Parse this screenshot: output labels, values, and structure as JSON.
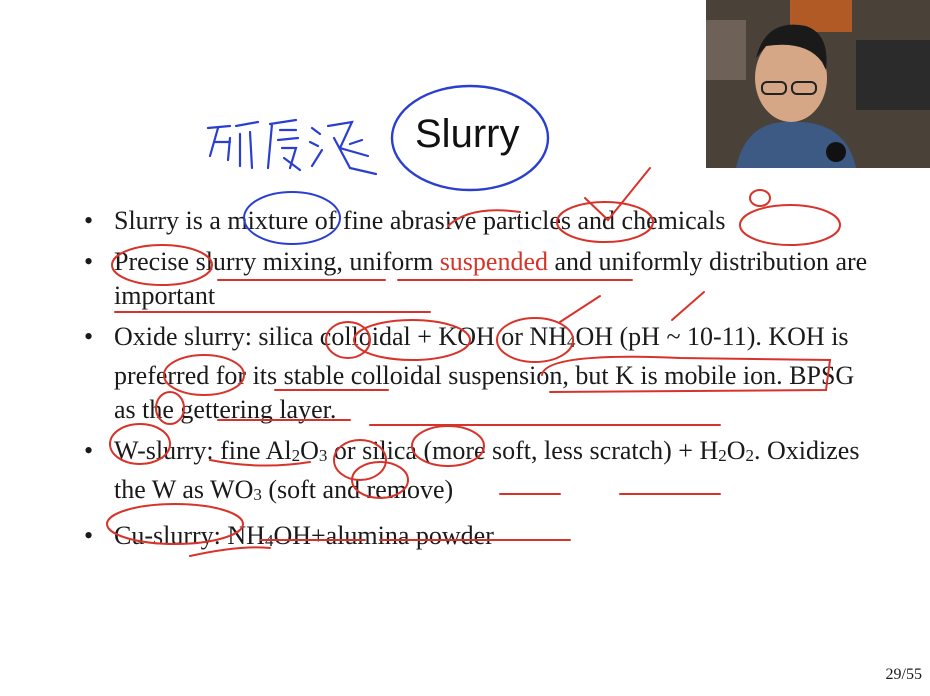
{
  "slide": {
    "title": "Slurry",
    "handwritten_note": "研磨液",
    "page": "29/55",
    "bullets": [
      {
        "parts": [
          "Slurry is a mixture of fine abrasive particles and chemicals"
        ]
      },
      {
        "pre": "Precise slurry mixing, uniform ",
        "red": "suspended",
        "post": " and uniformly distribution are important"
      },
      {
        "text": "Oxide slurry: silica colloidal + KOH or NH",
        "sub1": "4",
        "text2": "OH (pH ~ 10-11). KOH is preferred for its stable colloidal suspension, but K is mobile ion. BPSG as the gettering layer."
      },
      {
        "a": "W-slurry: fine Al",
        "s1": "2",
        "b": "O",
        "s2": "3",
        "c": " or silica (more soft, less scratch) + H",
        "s3": "2",
        "d": "O",
        "s4": "2",
        "e": ". Oxidizes the W as WO",
        "s5": "3",
        "f": " (soft and remove)"
      },
      {
        "a": "Cu-slurry: NH",
        "s1": "4",
        "b": "OH+alumina powder"
      }
    ],
    "bullet_symbol": "•"
  },
  "colors": {
    "ink_red": "#d8332a",
    "ink_blue": "#2a3fd0"
  },
  "video": {
    "description_icon": "webcam-presenter"
  }
}
